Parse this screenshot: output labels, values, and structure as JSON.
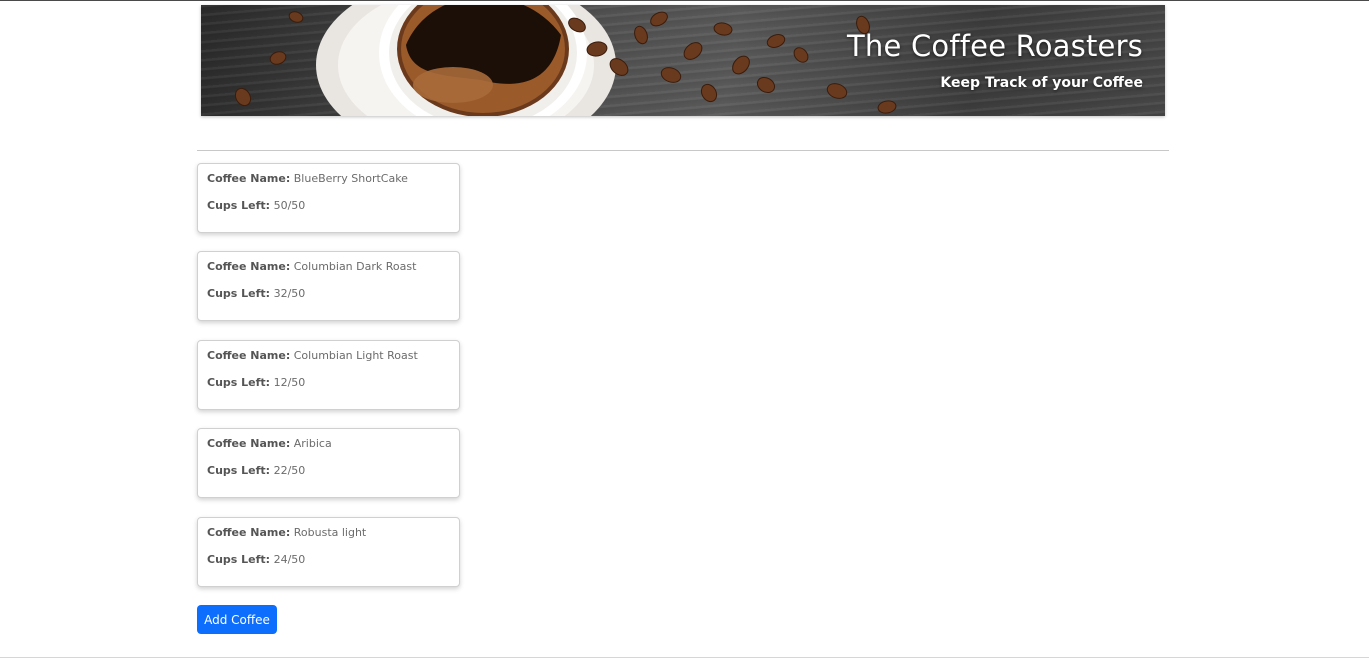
{
  "header": {
    "title": "The Coffee Roasters",
    "subtitle": "Keep Track of your Coffee"
  },
  "coffee": {
    "name_label": "Coffee Name:",
    "cups_label": "Cups Left:",
    "items": [
      {
        "name": "BlueBerry ShortCake",
        "cups": "50/50"
      },
      {
        "name": "Columbian Dark Roast",
        "cups": "32/50"
      },
      {
        "name": "Columbian Light Roast",
        "cups": "12/50"
      },
      {
        "name": "Aribica",
        "cups": "22/50"
      },
      {
        "name": "Robusta light",
        "cups": "24/50"
      }
    ]
  },
  "actions": {
    "add_label": "Add Coffee"
  },
  "colors": {
    "accent": "#0d6efd"
  }
}
